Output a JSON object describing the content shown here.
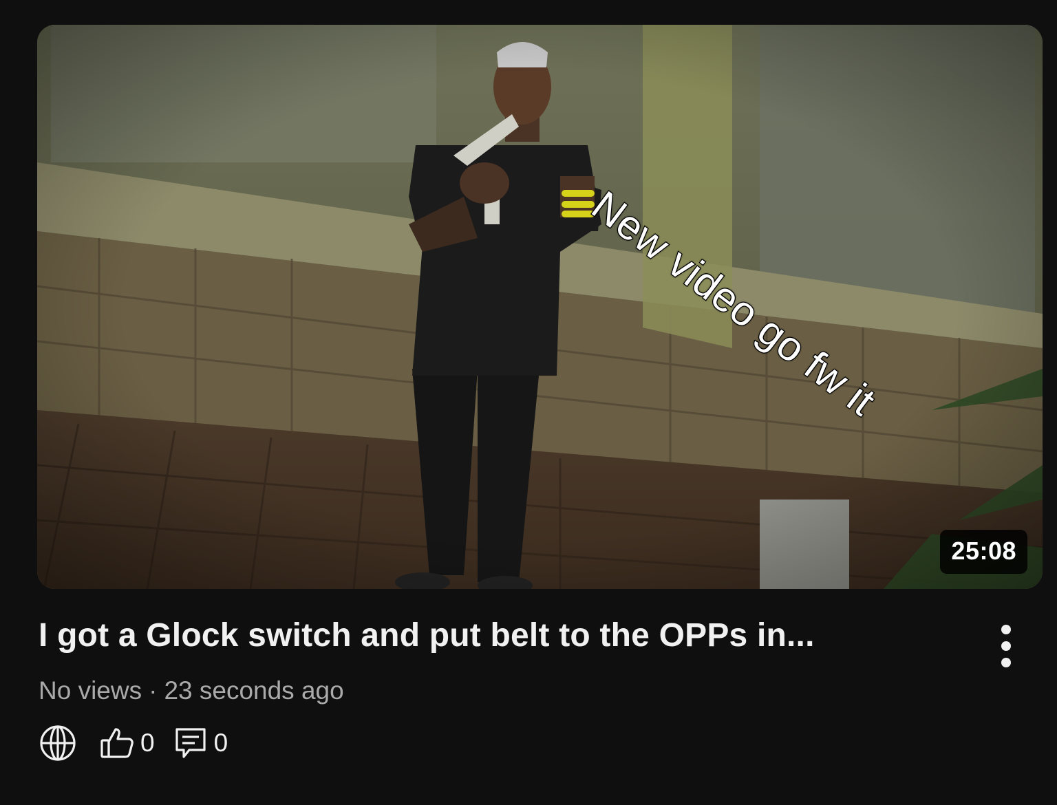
{
  "video": {
    "thumbnail_overlay_text": "New video go fw it",
    "duration": "25:08",
    "title": "I got a Glock switch and put belt to the OPPs in...",
    "views": "No views",
    "separator": "·",
    "uploaded": "23 seconds ago",
    "likes": "0",
    "comments": "0"
  },
  "icons": {
    "visibility": "globe-icon",
    "like": "thumbs-up-icon",
    "comment": "comment-icon",
    "more": "more-vertical-icon"
  }
}
